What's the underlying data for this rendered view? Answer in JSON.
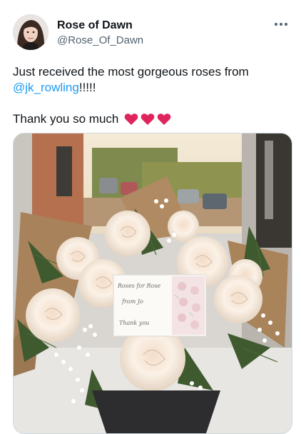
{
  "author": {
    "display_name": "Rose of Dawn",
    "handle": "@Rose_Of_Dawn"
  },
  "tweet": {
    "text_prefix": "Just received the most gorgeous roses from",
    "mention": "@jk_rowling",
    "text_suffix": "!!!!!",
    "second_line": "Thank you so much",
    "emoji_count": 3
  },
  "photo_card": {
    "line1": "Roses for Rose",
    "line2": "from Jo",
    "line3": "Thank you"
  },
  "colors": {
    "mention": "#1d9bf0",
    "heart": "#e0245e",
    "secondary_text": "#536471"
  },
  "icons": {
    "more": "more-horizontal-icon",
    "heart": "red-heart-emoji"
  }
}
